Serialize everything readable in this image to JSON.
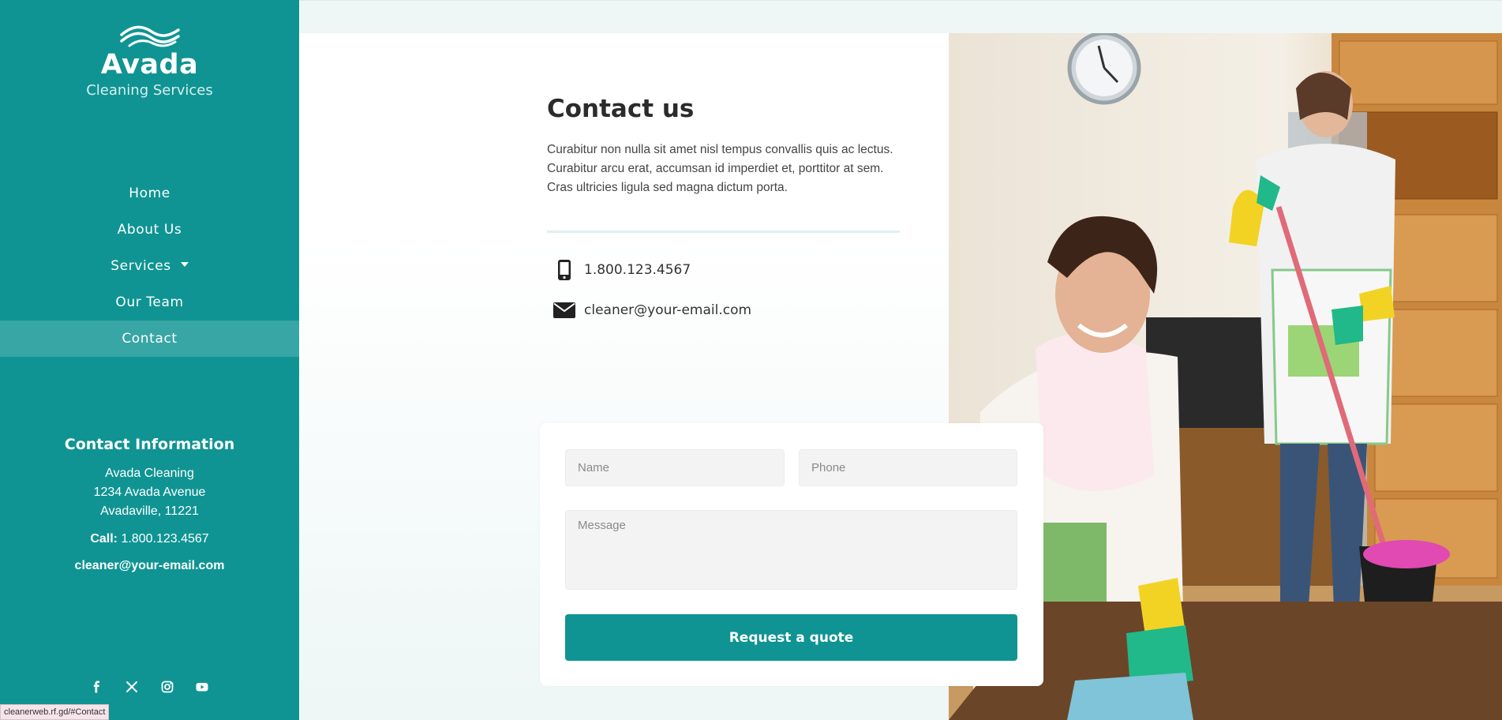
{
  "brand": {
    "title": "Avada",
    "subtitle": "Cleaning Services"
  },
  "nav": {
    "items": [
      {
        "label": "Home"
      },
      {
        "label": "About Us"
      },
      {
        "label": "Services"
      },
      {
        "label": "Our Team"
      },
      {
        "label": "Contact"
      }
    ],
    "active": "Contact"
  },
  "contact_info": {
    "title": "Contact Information",
    "address_lines": [
      "Avada Cleaning",
      "1234 Avada Avenue",
      "Avadaville, 11221"
    ],
    "call_label": "Call:",
    "call_value": "1.800.123.4567",
    "email": "cleaner@your-email.com"
  },
  "social": [
    "facebook-icon",
    "x-icon",
    "instagram-icon",
    "youtube-icon"
  ],
  "status_bar": {
    "url": "cleanerweb.rf.gd/#Contact"
  },
  "main": {
    "title": "Contact us",
    "description": "Curabitur non nulla sit amet nisl tempus convallis quis ac lectus. Curabitur arcu erat, accumsan id imperdiet et, porttitor at sem. Cras ultricies ligula sed magna dictum porta.",
    "phone": "1.800.123.4567",
    "email": "cleaner@your-email.com"
  },
  "form": {
    "name_placeholder": "Name",
    "phone_placeholder": "Phone",
    "message_placeholder": "Message",
    "submit_label": "Request a quote"
  },
  "colors": {
    "primary": "#0f9493",
    "active_nav": "#37a6a5",
    "page_bg": "#eef6f6"
  }
}
